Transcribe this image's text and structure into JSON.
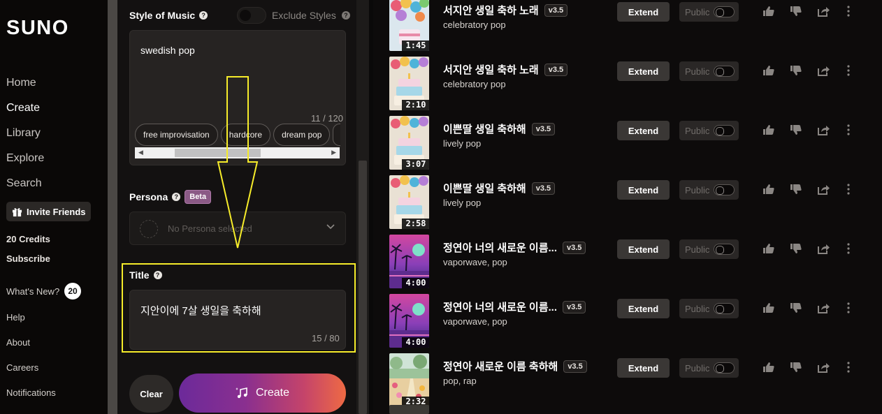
{
  "brand": "SUNO",
  "nav": {
    "items": [
      "Home",
      "Create",
      "Library",
      "Explore",
      "Search"
    ],
    "active": "Create",
    "invite": "Invite Friends",
    "credits": "20 Credits",
    "subscribe": "Subscribe",
    "whats_new": "What's New?",
    "whats_new_count": "20",
    "footer": [
      "Help",
      "About",
      "Careers",
      "Notifications"
    ]
  },
  "create": {
    "style_label": "Style of Music",
    "exclude_label": "Exclude Styles",
    "style_value": "swedish pop",
    "style_counter": "11 / 120",
    "style_chips": [
      "free improvisation",
      "hardcore",
      "dream pop"
    ],
    "persona_label": "Persona",
    "persona_badge": "Beta",
    "persona_placeholder": "No Persona selected",
    "title_label": "Title",
    "title_value": "지안이에 7살 생일을 축하해",
    "title_counter": "15 / 80",
    "clear_label": "Clear",
    "create_label": "Create"
  },
  "songs": [
    {
      "title": "서지안 생일 축하 노래",
      "version": "v3.5",
      "genre": "celebratory pop",
      "duration": "1:45",
      "art": "balloons"
    },
    {
      "title": "서지안 생일 축하 노래",
      "version": "v3.5",
      "genre": "celebratory pop",
      "duration": "2:10",
      "art": "cake"
    },
    {
      "title": "이쁜딸 생일 축하해",
      "version": "v3.5",
      "genre": "lively pop",
      "duration": "3:07",
      "art": "cake"
    },
    {
      "title": "이쁜딸 생일 축하해",
      "version": "v3.5",
      "genre": "lively pop",
      "duration": "2:58",
      "art": "cake"
    },
    {
      "title": "정연아 너의 새로운 이름...",
      "version": "v3.5",
      "genre": "vaporwave, pop",
      "duration": "4:00",
      "art": "vapor"
    },
    {
      "title": "정연아 너의 새로운 이름...",
      "version": "v3.5",
      "genre": "vaporwave, pop",
      "duration": "4:00",
      "art": "vapor"
    },
    {
      "title": "정연아 새로운 이름 축하해",
      "version": "v3.5",
      "genre": "pop, rap",
      "duration": "2:32",
      "art": "garden"
    }
  ],
  "song_actions": {
    "extend": "Extend",
    "public": "Public"
  },
  "colors": {
    "highlight": "#f6ec2a",
    "create_gradient_start": "#6c2a9a",
    "create_gradient_end": "#ee6a44"
  }
}
